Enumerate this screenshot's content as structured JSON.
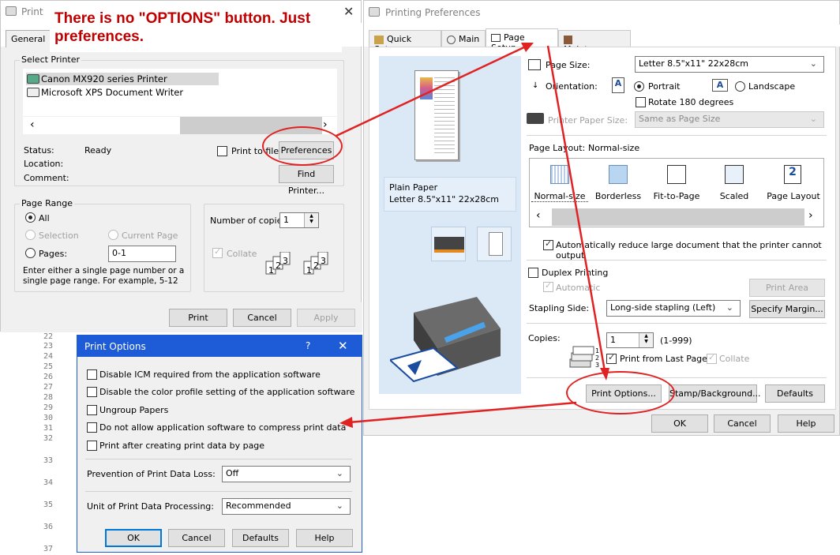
{
  "annotation": {
    "note": "There is no \"OPTIONS\" button. Just preferences."
  },
  "print_dialog": {
    "title": "Print",
    "tab": "General",
    "select_printer_label": "Select Printer",
    "printers": [
      "Canon MX920 series Printer",
      "Microsoft XPS Document Writer"
    ],
    "status_label": "Status:",
    "status_value": "Ready",
    "location_label": "Location:",
    "comment_label": "Comment:",
    "print_to_file": "Print to file",
    "preferences_btn": "Preferences",
    "find_printer_btn": "Find Printer...",
    "page_range_label": "Page Range",
    "all": "All",
    "selection": "Selection",
    "current_page": "Current Page",
    "pages": "Pages:",
    "pages_value": "0-1",
    "range_help": "Enter either a single page number or a single page range.  For example, 5-12",
    "copies_label": "Number of copies:",
    "copies_value": "1",
    "collate": "Collate",
    "print_btn": "Print",
    "cancel_btn": "Cancel",
    "apply_btn": "Apply"
  },
  "prefs_dialog": {
    "title": "Printing Preferences",
    "tabs": [
      "Quick Setup",
      "Main",
      "Page Setup",
      "Maintenance"
    ],
    "page_size_label": "Page Size:",
    "page_size_value": "Letter 8.5\"x11\" 22x28cm",
    "orientation_label": "Orientation:",
    "portrait": "Portrait",
    "landscape": "Landscape",
    "rotate": "Rotate 180 degrees",
    "printer_paper_size_label": "Printer Paper Size:",
    "printer_paper_size_value": "Same as Page Size",
    "page_layout_label": "Page Layout:",
    "page_layout_value": "Normal-size",
    "layouts": [
      "Normal-size",
      "Borderless",
      "Fit-to-Page",
      "Scaled",
      "Page Layout"
    ],
    "auto_reduce": "Automatically reduce large document that the printer cannot output",
    "duplex": "Duplex Printing",
    "automatic": "Automatic",
    "print_area_btn": "Print Area Setup...",
    "stapling_label": "Stapling Side:",
    "stapling_value": "Long-side stapling (Left)",
    "specify_margin_btn": "Specify Margin...",
    "copies_label": "Copies:",
    "copies_value": "1",
    "copies_range": "(1-999)",
    "print_from_last": "Print from Last Page",
    "collate": "Collate",
    "paper_preview_line1": "Plain Paper",
    "paper_preview_line2": "Letter 8.5\"x11\" 22x28cm",
    "print_options_btn": "Print Options...",
    "stamp_btn": "Stamp/Background...",
    "defaults_btn": "Defaults",
    "ok_btn": "OK",
    "cancel_btn": "Cancel",
    "help_btn": "Help"
  },
  "options_dialog": {
    "title": "Print Options",
    "help": "?",
    "checks": [
      "Disable ICM required from the application software",
      "Disable the color profile setting of the application software",
      "Ungroup Papers",
      "Do not allow application software to compress print data",
      "Print after creating print data by page"
    ],
    "prevention_label": "Prevention of Print Data Loss:",
    "prevention_value": "Off",
    "unit_label": "Unit of Print Data Processing:",
    "unit_value": "Recommended",
    "ok_btn": "OK",
    "cancel_btn": "Cancel",
    "defaults_btn": "Defaults",
    "help_btn": "Help"
  },
  "background_code": {
    "line_numbers": [
      "22",
      "23",
      "24",
      "25",
      "26",
      "27",
      "28",
      "29",
      "30",
      "31",
      "32",
      "33",
      "34",
      "35",
      "36",
      "37"
    ]
  },
  "colors": {
    "annotation_red": "#e12222",
    "note_text": "#c00000",
    "accent_blue": "#0078d7"
  }
}
